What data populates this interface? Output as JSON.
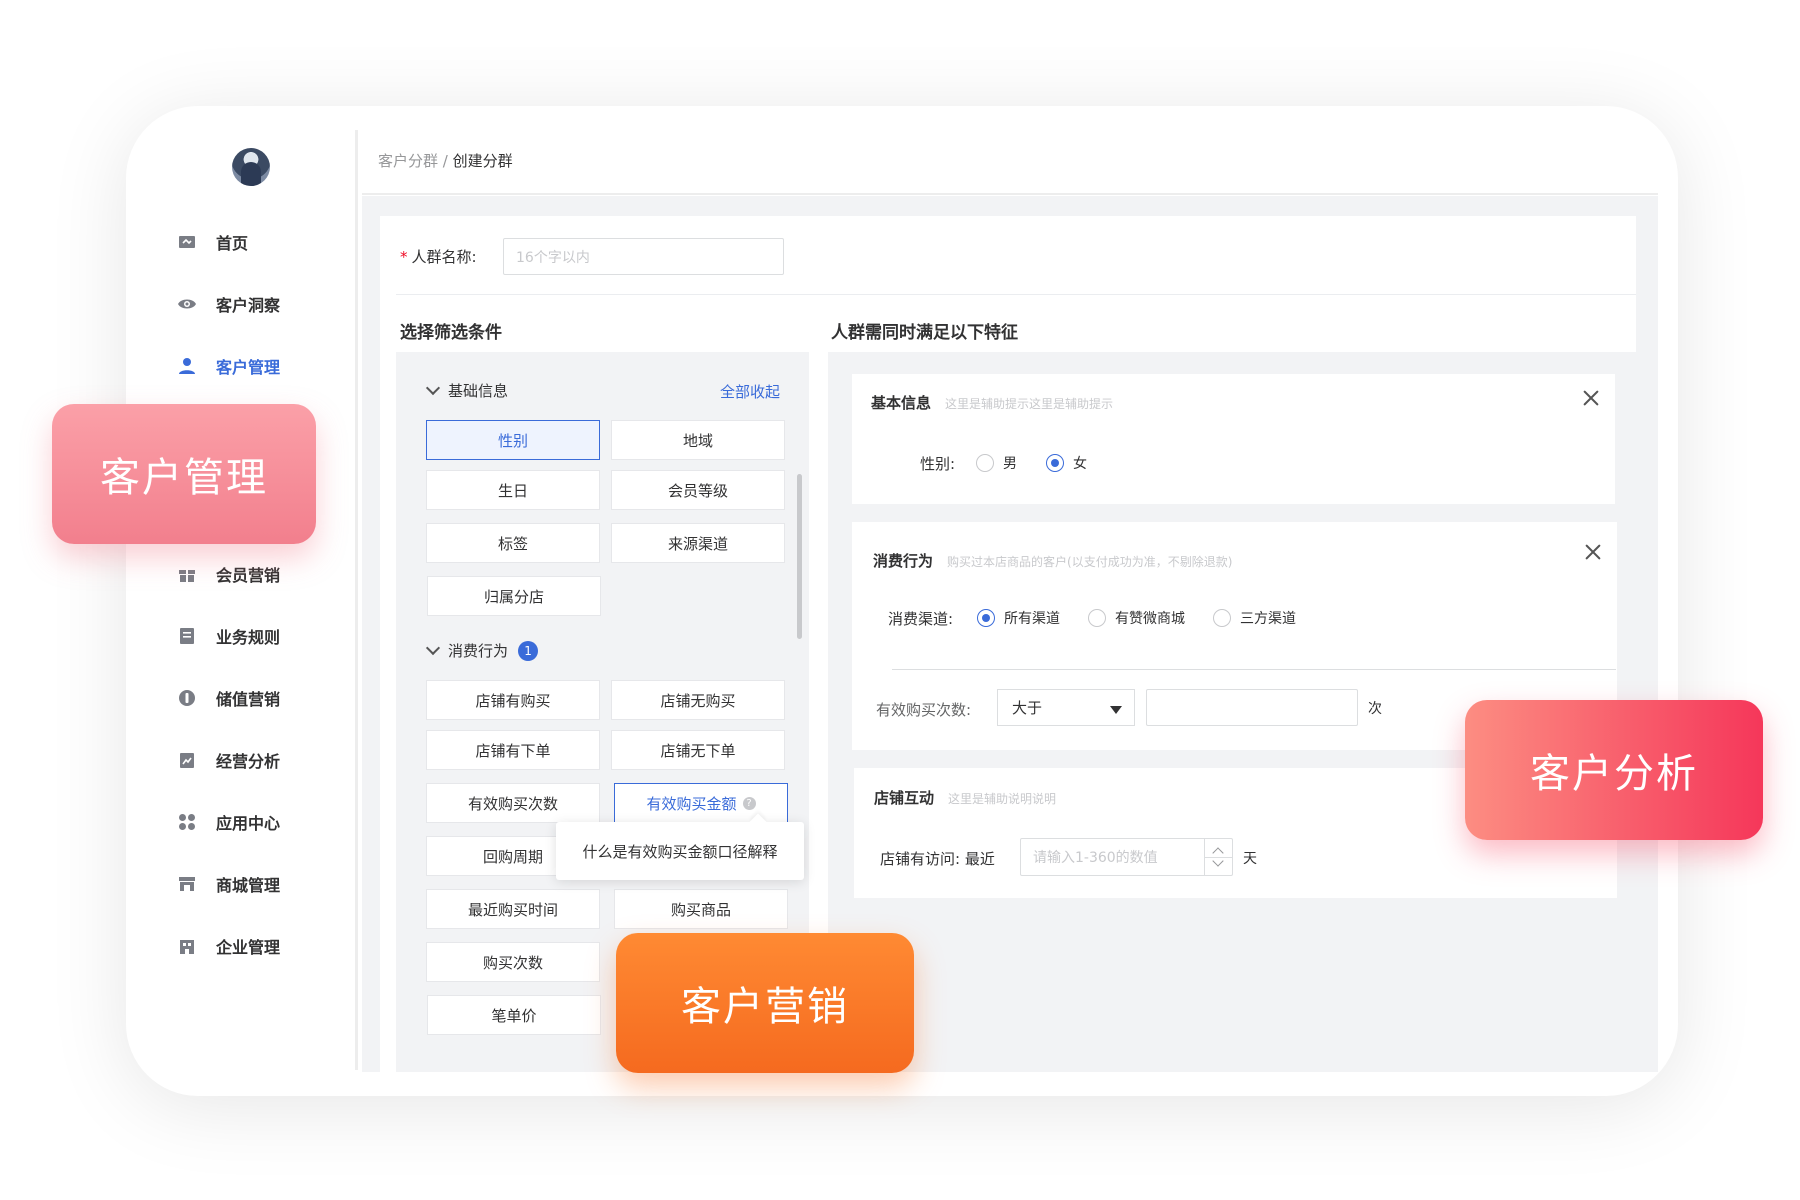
{
  "breadcrumb": {
    "parent": "客户分群",
    "sep": " / ",
    "current": "创建分群"
  },
  "sidebar": {
    "items": [
      {
        "label": "首页",
        "icon": "home-icon"
      },
      {
        "label": "客户洞察",
        "icon": "eye-icon"
      },
      {
        "label": "客户管理",
        "icon": "user-icon",
        "active": true
      },
      {
        "label": "会员营销",
        "icon": "gift-icon"
      },
      {
        "label": "业务规则",
        "icon": "document-icon"
      },
      {
        "label": "储值营销",
        "icon": "coin-icon"
      },
      {
        "label": "经营分析",
        "icon": "chart-icon"
      },
      {
        "label": "应用中心",
        "icon": "apps-icon"
      },
      {
        "label": "商城管理",
        "icon": "store-icon"
      },
      {
        "label": "企业管理",
        "icon": "building-icon"
      }
    ]
  },
  "form": {
    "name_label": "人群名称:",
    "name_placeholder": "16个字以内"
  },
  "left": {
    "title": "选择筛选条件",
    "collapse_all": "全部收起",
    "group1": {
      "title": "基础信息",
      "items": [
        "性别",
        "地域",
        "生日",
        "会员等级",
        "标签",
        "来源渠道",
        "归属分店"
      ]
    },
    "group2": {
      "title": "消费行为",
      "badge": "1",
      "items": [
        "店铺有购买",
        "店铺无购买",
        "店铺有下单",
        "店铺无下单",
        "有效购买次数",
        "有效购买金额",
        "回购周期",
        "最近购买时间",
        "购买商品",
        "购买次数",
        "笔单价"
      ]
    },
    "tooltip": "什么是有效购买金额口径解释"
  },
  "right": {
    "title": "人群需同时满足以下特征",
    "basic": {
      "title": "基本信息",
      "hint": "这里是辅助提示这里是辅助提示",
      "gender_label": "性别:",
      "options": [
        "男",
        "女"
      ],
      "selected": "女"
    },
    "consume": {
      "title": "消费行为",
      "hint": "购买过本店商品的客户(以支付成功为准，不剔除退款)",
      "channel_label": "消费渠道:",
      "channels": [
        "所有渠道",
        "有赞微商城",
        "三方渠道"
      ],
      "selected": "所有渠道",
      "count_label": "有效购买次数:",
      "compare_value": "大于",
      "unit": "次"
    },
    "interact": {
      "title": "店铺互动",
      "hint": "这里是辅助说明说明",
      "visit_label": "店铺有访问:",
      "recent": "最近",
      "placeholder": "请输入1-360的数值",
      "unit": "天"
    }
  },
  "overlays": {
    "manage": "客户管理",
    "analysis": "客户分析",
    "marketing": "客户营销"
  },
  "colors": {
    "accent": "#3a6bd9",
    "required": "#ee0a24"
  }
}
